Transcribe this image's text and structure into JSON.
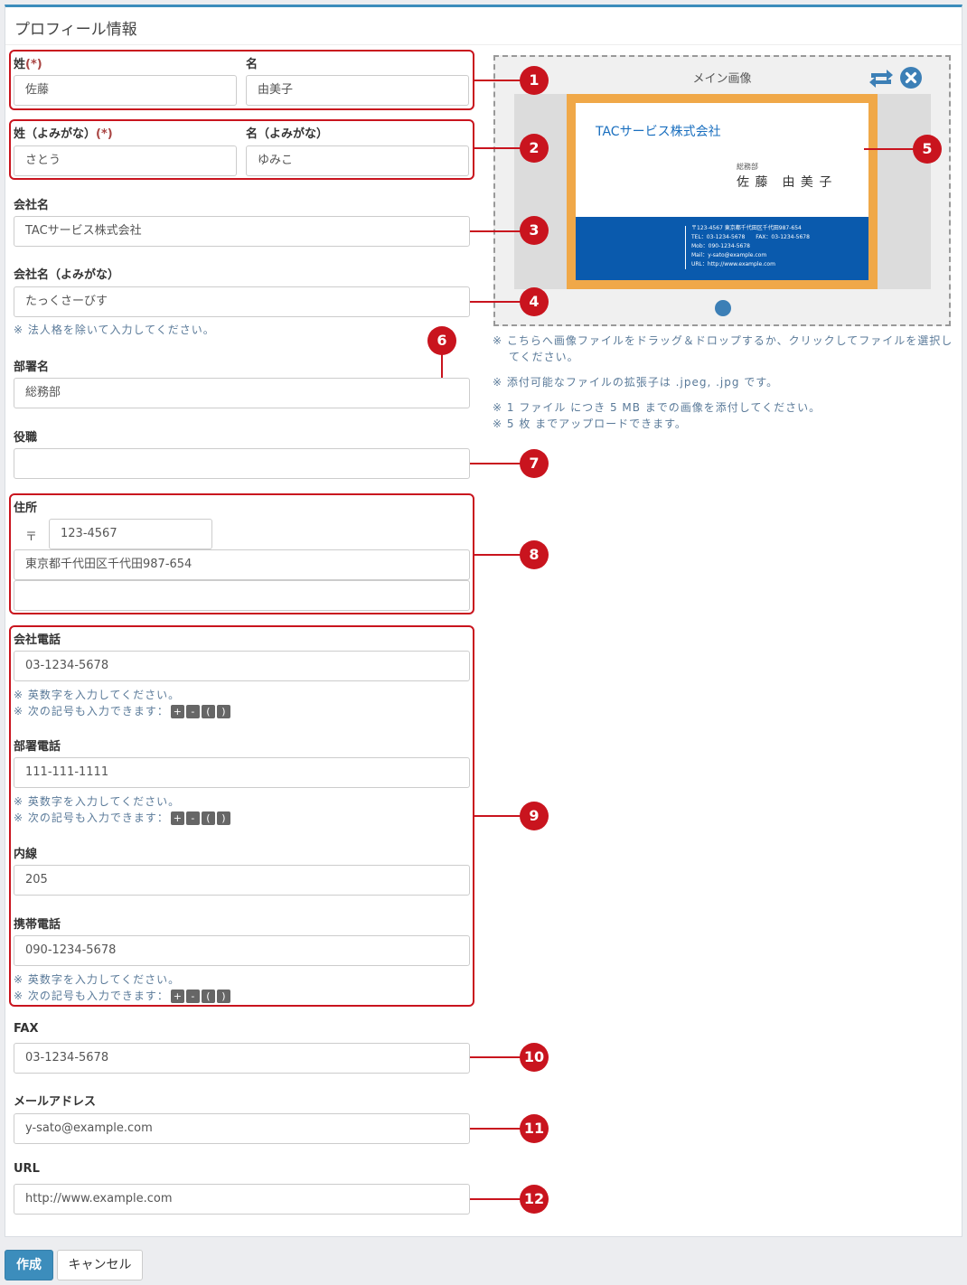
{
  "panel": {
    "title": "プロフィール情報"
  },
  "required_mark": "(*)",
  "fields": {
    "last_name": {
      "label": "姓",
      "value": "佐藤"
    },
    "first_name": {
      "label": "名",
      "value": "由美子"
    },
    "last_name_kana": {
      "label": "姓（よみがな）",
      "value": "さとう"
    },
    "first_name_kana": {
      "label": "名（よみがな）",
      "value": "ゆみこ"
    },
    "company": {
      "label": "会社名",
      "value": "TACサービス株式会社"
    },
    "company_kana": {
      "label": "会社名（よみがな）",
      "value": "たっくさーびす",
      "note": "※ 法人格を除いて入力してください。"
    },
    "department": {
      "label": "部署名",
      "value": "総務部"
    },
    "position": {
      "label": "役職",
      "value": ""
    },
    "address": {
      "label": "住所",
      "postal_mark": "〒",
      "postal_code": "123-4567",
      "line1": "東京都千代田区千代田987-654",
      "line2": ""
    },
    "company_phone": {
      "label": "会社電話",
      "value": "03-1234-5678"
    },
    "dept_phone": {
      "label": "部署電話",
      "value": "111-111-1111"
    },
    "extension": {
      "label": "内線",
      "value": "205"
    },
    "mobile": {
      "label": "携帯電話",
      "value": "090-1234-5678"
    },
    "fax": {
      "label": "FAX",
      "value": "03-1234-5678"
    },
    "email": {
      "label": "メールアドレス",
      "value": "y-sato@example.com"
    },
    "url": {
      "label": "URL",
      "value": "http://www.example.com"
    }
  },
  "phone_notes": {
    "line1": "※ 英数字を入力してください。",
    "line2": "※ 次の記号も入力できます：",
    "symbols": [
      "+",
      "-",
      "(",
      ")"
    ]
  },
  "image_upload": {
    "title": "メイン画像",
    "notes": [
      "※ こちらへ画像ファイルをドラッグ＆ドロップするか、クリックしてファイルを選択し",
      "てください。",
      "※ 添付可能なファイルの拡張子は .jpeg, .jpg です。",
      "※ 1 ファイル につき 5 MB までの画像を添付してください。",
      "※ 5 枚 までアップロードできます。"
    ]
  },
  "business_card": {
    "company": "TACサービス株式会社",
    "department": "総務部",
    "name": "佐 藤　由 美 子",
    "contact_lines": [
      "〒123-4567 東京都千代田区千代田987-654",
      "TEL：03-1234-5678　　FAX：03-1234-5678",
      "Mob：090-1234-5678",
      "Mail：y-sato@example.com",
      "URL：http://www.example.com"
    ]
  },
  "callouts": [
    "1",
    "2",
    "3",
    "4",
    "5",
    "6",
    "7",
    "8",
    "9",
    "10",
    "11",
    "12"
  ],
  "buttons": {
    "create": "作成",
    "cancel": "キャンセル"
  },
  "colors": {
    "accent": "#3c8dbc",
    "callout": "#c9141e",
    "card_frame": "#f0a848",
    "card_band": "#0a5aad",
    "create_button": "#3c8dbc"
  }
}
